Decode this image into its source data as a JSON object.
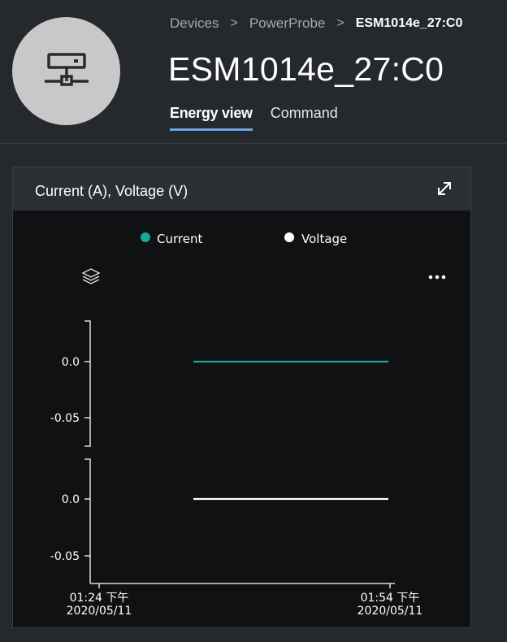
{
  "breadcrumb": {
    "items": [
      "Devices",
      "PowerProbe"
    ],
    "current": "ESM1014e_27:C0"
  },
  "device": {
    "title": "ESM1014e_27:C0",
    "avatar_icon": "network-device-icon"
  },
  "tabs": [
    {
      "label": "Energy view",
      "active": true
    },
    {
      "label": "Command",
      "active": false
    }
  ],
  "card": {
    "title": "Current (A), Voltage (V)",
    "expand_icon": "expand-icon"
  },
  "toolbar": {
    "layers_icon": "layers-icon",
    "more_icon": "more-options-icon"
  },
  "colors": {
    "accent": "#6ba7e0",
    "current": "#17a99a",
    "voltage": "#ffffff",
    "background": "#25282c"
  },
  "chart_data": {
    "type": "line",
    "legend": [
      {
        "name": "Current",
        "color": "#17a99a"
      },
      {
        "name": "Voltage",
        "color": "#ffffff"
      }
    ],
    "legend_position": "top",
    "x_ticks": [
      {
        "time": "01:24 下午",
        "date": "2020/05/11"
      },
      {
        "time": "01:54 下午",
        "date": "2020/05/11"
      }
    ],
    "panels": [
      {
        "series": "Current",
        "y_ticks": [
          "0.0",
          "-0.05"
        ],
        "x": [
          "2020/05/11 01:32 下午",
          "2020/05/11 01:53 下午"
        ],
        "values": [
          0.0,
          0.0
        ]
      },
      {
        "series": "Voltage",
        "y_ticks": [
          "0.0",
          "-0.05"
        ],
        "x": [
          "2020/05/11 01:32 下午",
          "2020/05/11 01:53 下午"
        ],
        "values": [
          0.0,
          0.0
        ]
      }
    ],
    "grid": false
  }
}
